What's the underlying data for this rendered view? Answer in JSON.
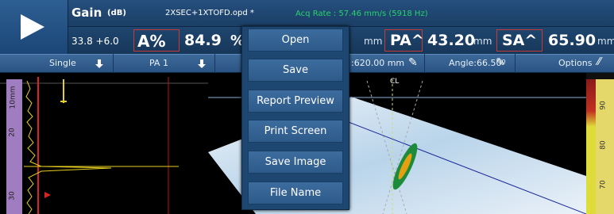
{
  "header": {
    "gain_label": "Gain",
    "gain_unit": "(dB)",
    "gain_value": "33.8 +6.0",
    "filename": "2XSEC+1XTOFD.opd *",
    "acq_rate": "Acq Rate : 57.46 mm/s (5918 Hz)",
    "readouts": {
      "a_label": "A%",
      "a_value": "84.9",
      "a_unit": "%",
      "pa_prefix": "mm",
      "pa_label": "PA^",
      "pa_value": "43.20",
      "pa_unit": "mm",
      "sa_label": "SA^",
      "sa_value": "65.90",
      "sa_unit": "mm"
    }
  },
  "toolbar": {
    "mode": "Single",
    "group": "PA 1",
    "position": ":620.00 mm",
    "angle": "Angle:66.50º",
    "options": "Options"
  },
  "scan": {
    "cl_label": "CL",
    "left_ruler_ticks": [
      "10mm",
      "20",
      "30"
    ],
    "right_ruler_ticks": [
      "90",
      "80",
      "70"
    ]
  },
  "menu": {
    "items": [
      "Open",
      "Save",
      "Report Preview",
      "Print Screen",
      "Save Image",
      "File Name"
    ]
  }
}
